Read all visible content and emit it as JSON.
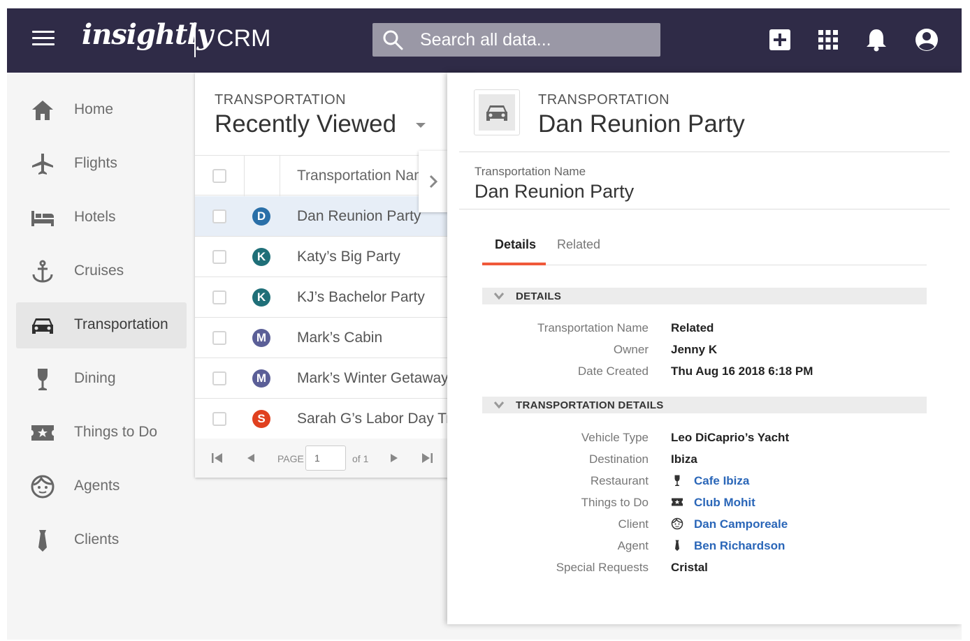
{
  "topbar": {
    "logo": "insightly",
    "app_name": "CRM",
    "search_placeholder": "Search all data..."
  },
  "sidebar": {
    "items": [
      {
        "label": "Home",
        "icon": "home-icon"
      },
      {
        "label": "Flights",
        "icon": "airplane-icon"
      },
      {
        "label": "Hotels",
        "icon": "bed-icon"
      },
      {
        "label": "Cruises",
        "icon": "anchor-icon"
      },
      {
        "label": "Transportation",
        "icon": "car-icon",
        "active": true
      },
      {
        "label": "Dining",
        "icon": "wine-glass-icon"
      },
      {
        "label": "Things to Do",
        "icon": "ticket-star-icon"
      },
      {
        "label": "Agents",
        "icon": "face-icon"
      },
      {
        "label": "Clients",
        "icon": "tie-icon"
      }
    ]
  },
  "list": {
    "eyebrow": "TRANSPORTATION",
    "title": "Recently Viewed",
    "column_header": "Transportation Name",
    "rows": [
      {
        "initial": "D",
        "label": "Dan Reunion Party",
        "color": "#2a6fa8"
      },
      {
        "initial": "K",
        "label": "Katy’s Big Party",
        "color": "#1f6f78"
      },
      {
        "initial": "K",
        "label": "KJ’s Bachelor Party",
        "color": "#1f6f78"
      },
      {
        "initial": "M",
        "label": "Mark’s Cabin",
        "color": "#5b5f97"
      },
      {
        "initial": "M",
        "label": "Mark’s Winter Getaway",
        "color": "#5b5f97"
      },
      {
        "initial": "S",
        "label": "Sarah G’s Labor Day Trip",
        "color": "#e0401f"
      }
    ],
    "pager": {
      "page_label": "PAGE",
      "page_value": "1",
      "of_label": "of 1"
    }
  },
  "detail": {
    "eyebrow": "TRANSPORTATION",
    "title": "Dan Reunion Party",
    "name_label": "Transportation Name",
    "name_value": "Dan Reunion Party",
    "tabs": {
      "details": "Details",
      "related": "Related"
    },
    "section1": {
      "title": "DETAILS",
      "fields": [
        {
          "label": "Transportation Name",
          "value": "Related"
        },
        {
          "label": "Owner",
          "value": "Jenny K"
        },
        {
          "label": "Date Created",
          "value": "Thu Aug 16 2018 6:18 PM"
        }
      ]
    },
    "section2": {
      "title": "TRANSPORTATION DETAILS",
      "fields": [
        {
          "label": "Vehicle Type",
          "value": "Leo DiCaprio’s Yacht"
        },
        {
          "label": "Destination",
          "value": "Ibiza"
        },
        {
          "label": "Restaurant",
          "value": "Cafe Ibiza",
          "icon": "wine-glass-icon"
        },
        {
          "label": "Things to Do",
          "value": "Club Mohit",
          "icon": "ticket-star-icon"
        },
        {
          "label": "Client",
          "value": "Dan Camporeale",
          "icon": "face-icon"
        },
        {
          "label": "Agent",
          "value": "Ben Richardson",
          "icon": "tie-icon"
        },
        {
          "label": "Special Requests",
          "value": "Cristal"
        }
      ]
    }
  },
  "colors": {
    "topbar": "#2f2b47",
    "accent": "#f0593a",
    "link": "#2a66b8",
    "selected_row": "#e7eef7"
  }
}
